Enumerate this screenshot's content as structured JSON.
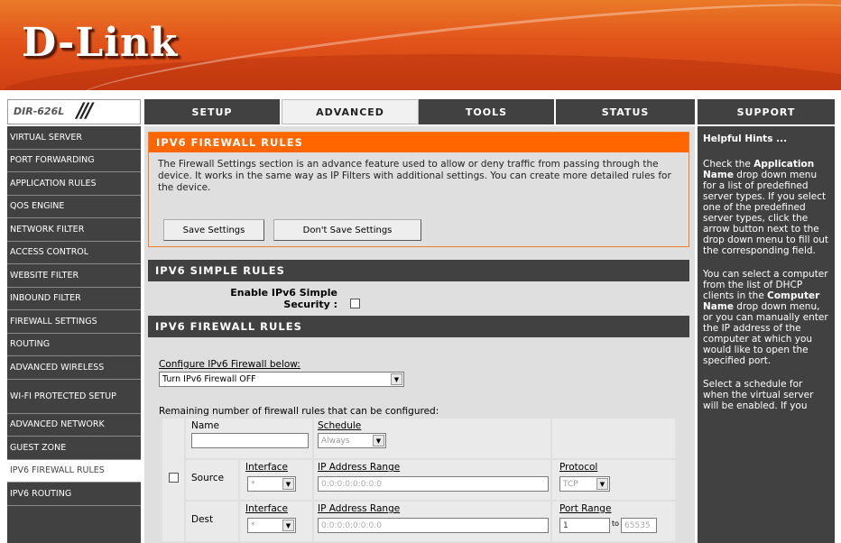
{
  "brand": {
    "logo": "D-Link",
    "model": "DIR-626L",
    "slash": "///"
  },
  "tabs": [
    {
      "label": "SETUP",
      "active": false
    },
    {
      "label": "ADVANCED",
      "active": true
    },
    {
      "label": "TOOLS",
      "active": false
    },
    {
      "label": "STATUS",
      "active": false
    }
  ],
  "support_tab": "SUPPORT",
  "nav": [
    "VIRTUAL SERVER",
    "PORT FORWARDING",
    "APPLICATION RULES",
    "QOS ENGINE",
    "NETWORK FILTER",
    "ACCESS CONTROL",
    "WEBSITE FILTER",
    "INBOUND FILTER",
    "FIREWALL SETTINGS",
    "ROUTING",
    "ADVANCED WIRELESS",
    "WI-FI PROTECTED SETUP",
    "ADVANCED NETWORK",
    "GUEST ZONE",
    "IPV6 FIREWALL RULES",
    "IPV6 ROUTING"
  ],
  "nav_active_index": 14,
  "main": {
    "section1_title": "IPV6 FIREWALL RULES",
    "intro": "The Firewall Settings section is an advance feature used to allow or deny traffic from passing through the device. It works in the same way as IP Filters with additional settings. You can create more detailed rules for the device.",
    "save_button": "Save Settings",
    "dont_save_button": "Don't Save Settings",
    "section2_title": "IPV6 SIMPLE RULES",
    "simple_label": "Enable IPv6 Simple Security :",
    "section3_title": "IPV6 FIREWALL RULES",
    "config_label": "Configure IPv6 Firewall below:",
    "config_value": "Turn IPv6 Firewall OFF",
    "remaining_label": "Remaining number of firewall rules that can be configured:",
    "rule": {
      "name_label": "Name",
      "schedule_label": "Schedule",
      "schedule_value": "Always",
      "source_label": "Source",
      "dest_label": "Dest",
      "interface_label": "Interface",
      "interface_value": "*",
      "ip_range_label": "IP Address Range",
      "ip_placeholder": "0:0:0:0:0:0:0:0",
      "protocol_label": "Protocol",
      "protocol_value": "TCP",
      "port_range_label": "Port Range",
      "port_from": "1",
      "port_to": "65535",
      "port_sep": "to"
    }
  },
  "hints": {
    "title": "Helpful Hints ...",
    "p1_pre": "Check the ",
    "p1_bold": "Application Name",
    "p1_post": " drop down menu for a list of predefined server types. If you select one of the predefined server types, click the arrow button next to the drop down menu to fill out the corresponding field.",
    "p2_pre": "You can select a computer from the list of DHCP clients in the ",
    "p2_bold": "Computer Name",
    "p2_post": " drop down menu, or you can manually enter the IP address of the computer at which you would like to open the specified port.",
    "p3": "Select a schedule for when the virtual server will be enabled. If you"
  }
}
